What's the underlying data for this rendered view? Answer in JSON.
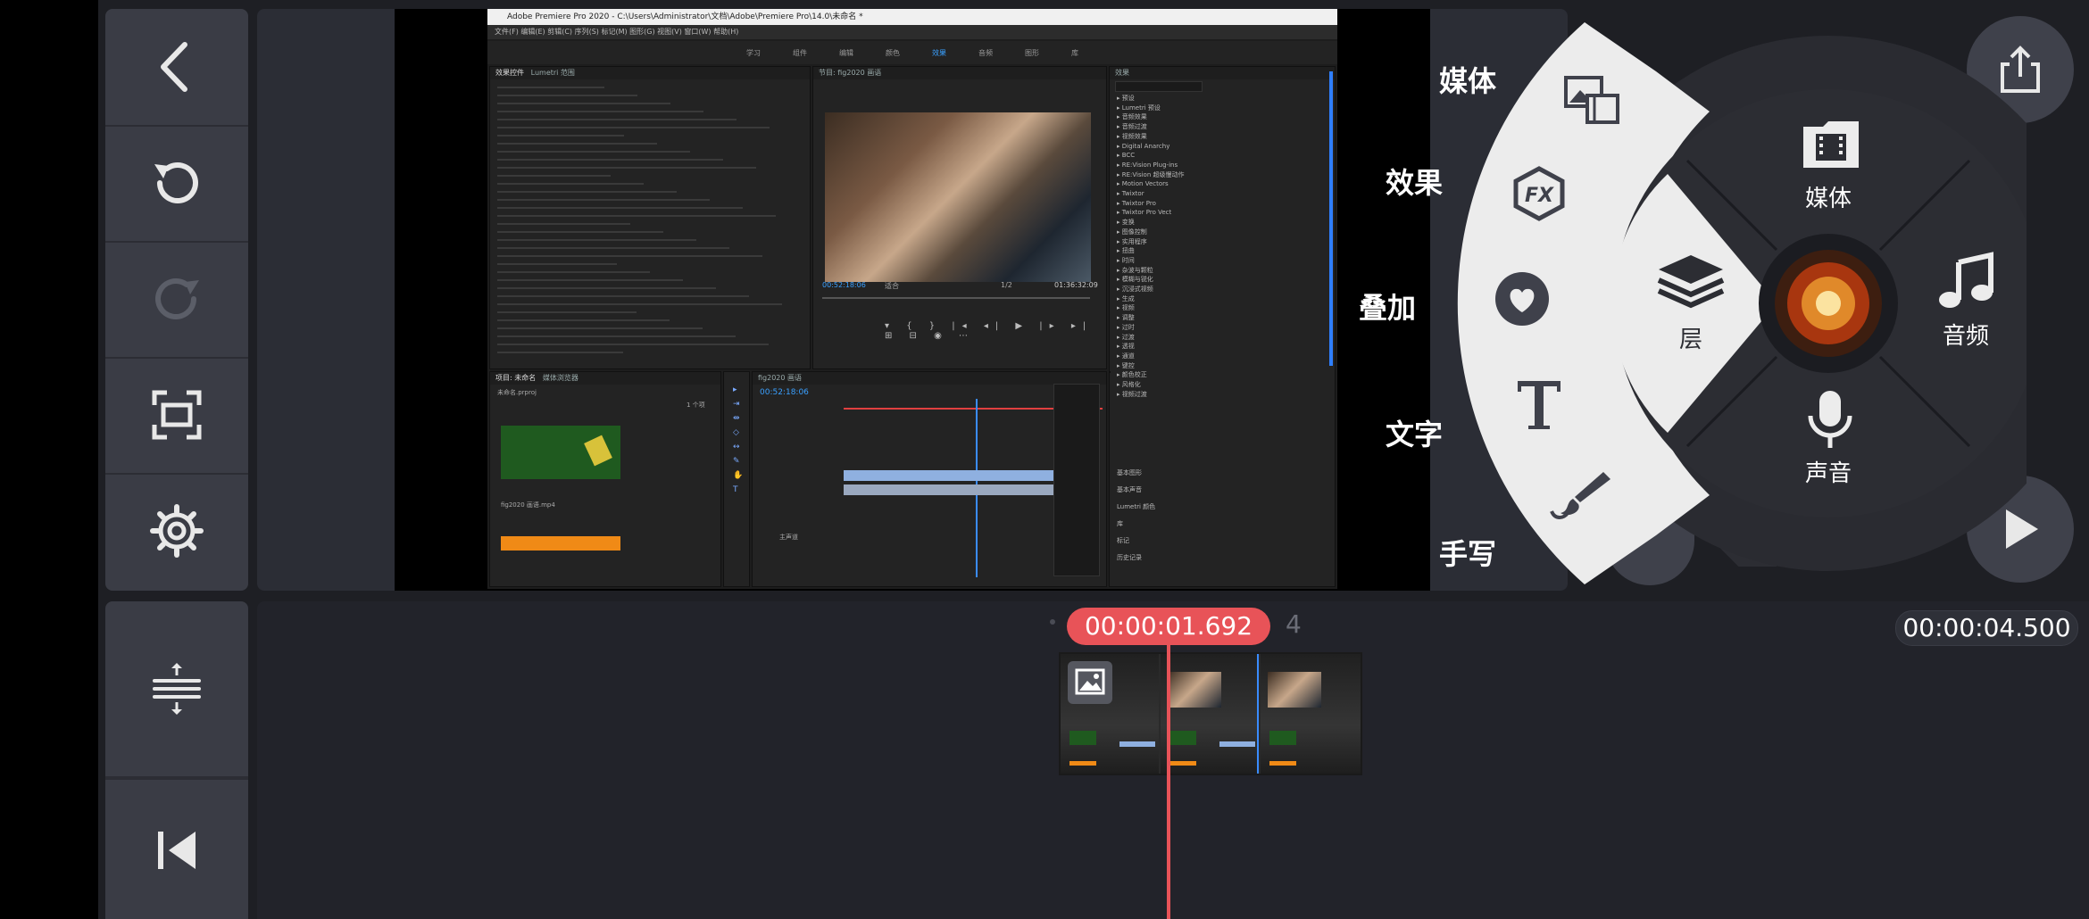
{
  "toolbar": {
    "back": "back-icon",
    "undo": "undo-icon",
    "redo": "redo-icon",
    "capture": "capture-icon",
    "settings": "gear-icon",
    "track_adjust": "track-height-icon",
    "to_start": "skip-to-start-icon"
  },
  "premiere": {
    "title": "Adobe Premiere Pro 2020 - C:\\Users\\Administrator\\文档\\Adobe\\Premiere Pro\\14.0\\未命名 *",
    "menu": "文件(F)  编辑(E)  剪辑(C)  序列(S)  标记(M)  图形(G)  视图(V)  窗口(W)  帮助(H)",
    "workspaces": [
      "学习",
      "组件",
      "编辑",
      "颜色",
      "效果",
      "音频",
      "图形",
      "库"
    ],
    "effect_controls_tab": "效果控件",
    "lumetri_tab": "Lumetri 范围",
    "program_title": "节目: fig2020 画语",
    "program_timecode": "00:52:18:06",
    "program_fit": "适合",
    "program_fraction": "1/2",
    "program_duration": "01:36:32:09",
    "project_tab": "项目: 未命名",
    "media_browser_tab": "媒体浏览器",
    "project_file": "未命名.prproj",
    "items_count": "1 个项",
    "clip_name": "fig2020 画语.mp4",
    "sequence_tab": "fig2020 画语",
    "sequence_timecode": "00:52:18:06",
    "master_track": "主声道",
    "effects_tab": "效果",
    "effect_folders": [
      "预设",
      "Lumetri 预设",
      "音频效果",
      "音频过渡",
      "视频效果",
      "Digital Anarchy",
      "BCC",
      "RE:Vision Plug-ins",
      "RE:Vision 超级慢动作",
      "Motion Vectors",
      "Twixtor",
      "Twixtor Pro",
      "Twixtor Pro Vect",
      "变换",
      "图像控制",
      "实用程序",
      "扭曲",
      "时间",
      "杂波与颗粒",
      "模糊与锐化",
      "沉浸式视频",
      "生成",
      "视频",
      "调整",
      "过时",
      "过渡",
      "透视",
      "通道",
      "键控",
      "颜色校正",
      "风格化",
      "视频过渡"
    ],
    "effect_bottom": [
      "基本图形",
      "基本声音",
      "Lumetri 颜色",
      "库",
      "标记",
      "历史记录"
    ]
  },
  "wheel": {
    "outer_labels": {
      "media": "媒体",
      "effects": "效果",
      "overlay": "叠加",
      "text": "文字",
      "handwriting": "手写"
    },
    "inner": {
      "media": "媒体",
      "layer": "层",
      "audio": "音频",
      "voice": "声音"
    },
    "icons": {
      "media": "image-film-icon",
      "fx": "fx-icon",
      "sticker": "heart-sticker-icon",
      "text": "text-T-icon",
      "brush": "brush-icon"
    }
  },
  "timeline": {
    "current_time": "00:00:01.692",
    "total_time": "00:00:04.500",
    "clip_count": "4"
  },
  "colors": {
    "accent": "#e85358",
    "panel": "#3a3c45",
    "background": "#1e1f24",
    "wheel_outer": "#ececec",
    "wheel_dark": "#2c2d33"
  }
}
